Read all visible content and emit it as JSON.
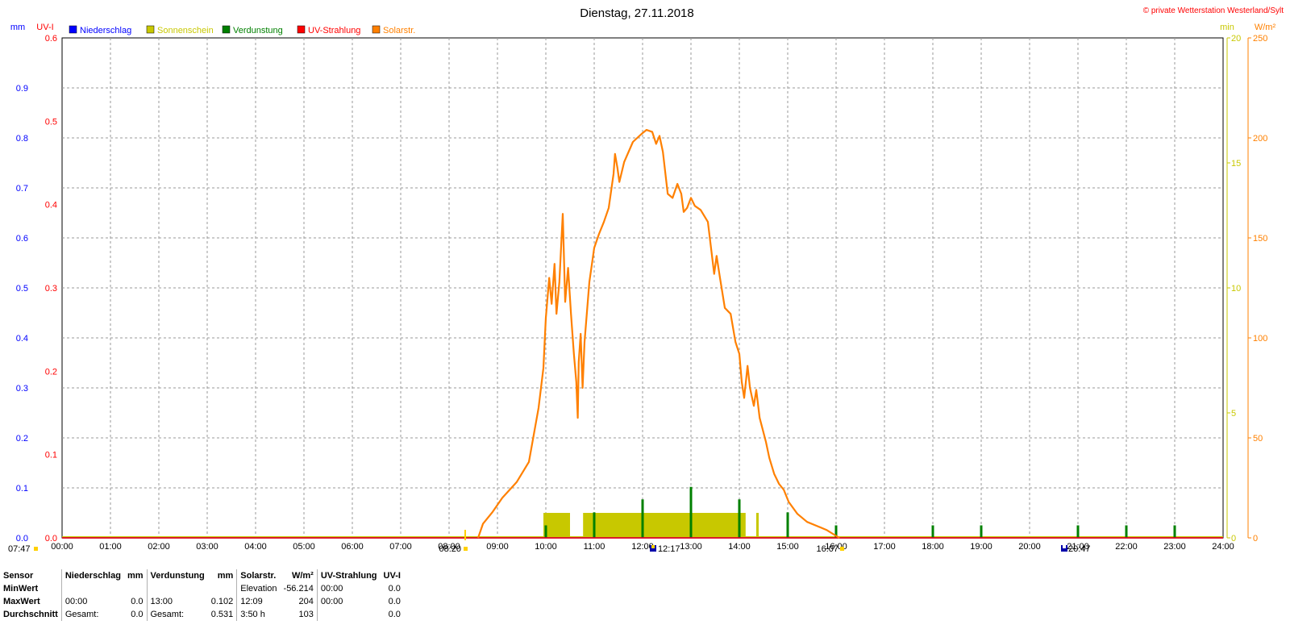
{
  "title": "Dienstag, 27.11.2018",
  "copyright": "© private Wetterstation Westerland/Sylt",
  "legend": [
    {
      "label": "Niederschlag",
      "color": "#0000ff"
    },
    {
      "label": "Sonnenschein",
      "color": "#c8c800"
    },
    {
      "label": "Verdunstung",
      "color": "#008000"
    },
    {
      "label": "UV-Strahlung",
      "color": "#ff0000"
    },
    {
      "label": "Solarstr.",
      "color": "#ff8000"
    }
  ],
  "units": {
    "mm": "mm",
    "uv": "UV-I",
    "min": "min",
    "wm2": "W/m²"
  },
  "sun_markers": {
    "sunrise_civil": "07:47",
    "sunrise": "08:20",
    "noon": "12:17",
    "sunset": "16:07",
    "moon": "20:47"
  },
  "chart_data": {
    "type": "line",
    "title": "Dienstag, 27.11.2018",
    "x_ticks": [
      "00:00",
      "01:00",
      "02:00",
      "03:00",
      "04:00",
      "05:00",
      "06:00",
      "07:00",
      "08:00",
      "09:00",
      "10:00",
      "11:00",
      "12:00",
      "13:00",
      "14:00",
      "15:00",
      "16:00",
      "17:00",
      "18:00",
      "19:00",
      "20:00",
      "21:00",
      "22:00",
      "23:00",
      "24:00"
    ],
    "x_range_hours": [
      0,
      24
    ],
    "axes": {
      "mm": {
        "range": [
          0,
          1.0
        ],
        "ticks": [
          "0.0",
          "0.1",
          "0.2",
          "0.3",
          "0.4",
          "0.5",
          "0.6",
          "0.7",
          "0.8",
          "0.9"
        ],
        "color": "#0000ff"
      },
      "uv": {
        "range": [
          0,
          0.6
        ],
        "ticks": [
          "0.0",
          "0.1",
          "0.2",
          "0.3",
          "0.4",
          "0.5",
          "0.6"
        ],
        "color": "#ff0000"
      },
      "min": {
        "range": [
          0,
          20
        ],
        "ticks": [
          "0",
          "5",
          "10",
          "15",
          "20"
        ],
        "color": "#c8c800"
      },
      "wm2": {
        "range": [
          0,
          250
        ],
        "ticks": [
          "0",
          "50",
          "100",
          "150",
          "200",
          "250"
        ],
        "color": "#ff8000"
      }
    },
    "grid": true,
    "series": [
      {
        "name": "Solarstr.",
        "axis": "wm2",
        "color": "#ff8000",
        "points": [
          [
            8.6,
            0
          ],
          [
            8.7,
            7
          ],
          [
            8.9,
            13
          ],
          [
            9.1,
            20
          ],
          [
            9.4,
            28
          ],
          [
            9.65,
            38
          ],
          [
            9.85,
            65
          ],
          [
            9.95,
            85
          ],
          [
            10.0,
            110
          ],
          [
            10.07,
            130
          ],
          [
            10.12,
            117
          ],
          [
            10.18,
            137
          ],
          [
            10.22,
            112
          ],
          [
            10.28,
            128
          ],
          [
            10.35,
            162
          ],
          [
            10.4,
            118
          ],
          [
            10.46,
            135
          ],
          [
            10.52,
            112
          ],
          [
            10.58,
            92
          ],
          [
            10.63,
            78
          ],
          [
            10.66,
            60
          ],
          [
            10.68,
            88
          ],
          [
            10.72,
            102
          ],
          [
            10.76,
            75
          ],
          [
            10.8,
            98
          ],
          [
            10.9,
            128
          ],
          [
            11.0,
            145
          ],
          [
            11.1,
            152
          ],
          [
            11.2,
            158
          ],
          [
            11.3,
            165
          ],
          [
            11.4,
            182
          ],
          [
            11.43,
            192
          ],
          [
            11.48,
            185
          ],
          [
            11.52,
            178
          ],
          [
            11.62,
            188
          ],
          [
            11.8,
            198
          ],
          [
            11.98,
            202
          ],
          [
            12.08,
            204
          ],
          [
            12.2,
            203
          ],
          [
            12.28,
            197
          ],
          [
            12.35,
            201
          ],
          [
            12.42,
            193
          ],
          [
            12.52,
            172
          ],
          [
            12.62,
            170
          ],
          [
            12.72,
            177
          ],
          [
            12.8,
            172
          ],
          [
            12.85,
            163
          ],
          [
            12.92,
            165
          ],
          [
            13.0,
            170
          ],
          [
            13.08,
            166
          ],
          [
            13.2,
            164
          ],
          [
            13.35,
            158
          ],
          [
            13.42,
            144
          ],
          [
            13.48,
            132
          ],
          [
            13.53,
            141
          ],
          [
            13.6,
            130
          ],
          [
            13.7,
            115
          ],
          [
            13.82,
            112
          ],
          [
            13.92,
            98
          ],
          [
            14.0,
            92
          ],
          [
            14.05,
            78
          ],
          [
            14.1,
            70
          ],
          [
            14.17,
            86
          ],
          [
            14.22,
            75
          ],
          [
            14.3,
            66
          ],
          [
            14.35,
            74
          ],
          [
            14.42,
            60
          ],
          [
            14.55,
            48
          ],
          [
            14.62,
            40
          ],
          [
            14.72,
            32
          ],
          [
            14.82,
            27
          ],
          [
            14.92,
            24
          ],
          [
            15.02,
            18
          ],
          [
            15.2,
            12
          ],
          [
            15.4,
            8
          ],
          [
            15.6,
            6
          ],
          [
            15.8,
            4
          ],
          [
            16.0,
            1
          ],
          [
            16.07,
            0
          ]
        ]
      },
      {
        "name": "Sonnenschein",
        "axis": "min",
        "color": "#c8c800",
        "blocks": [
          [
            9.95,
            10.5,
            1.0
          ],
          [
            10.77,
            14.13,
            1.0
          ],
          [
            14.35,
            14.4,
            1.0
          ]
        ]
      },
      {
        "name": "Verdunstung",
        "axis": "mm",
        "color": "#008000",
        "spikes": [
          [
            10.0,
            0.025
          ],
          [
            11.0,
            0.051
          ],
          [
            12.0,
            0.077
          ],
          [
            13.0,
            0.102
          ],
          [
            14.0,
            0.077
          ],
          [
            15.0,
            0.051
          ],
          [
            16.0,
            0.025
          ],
          [
            18.0,
            0.025
          ],
          [
            19.0,
            0.025
          ],
          [
            21.0,
            0.025
          ],
          [
            22.0,
            0.025
          ],
          [
            23.0,
            0.025
          ]
        ]
      },
      {
        "name": "Niederschlag",
        "axis": "mm",
        "color": "#0000ff",
        "constant": 0.0
      },
      {
        "name": "UV-Strahlung",
        "axis": "uv",
        "color": "#ff0000",
        "constant": 0.0
      }
    ]
  },
  "stats": {
    "headers": {
      "sensor": "Sensor",
      "niederschlag": "Niederschlag",
      "mm1": "mm",
      "verdunstung": "Verdunstung",
      "mm2": "mm",
      "solar": "Solarstr.",
      "wm2": "W/m²",
      "uv": "UV-Strahlung",
      "uvi": "UV-I"
    },
    "rows": [
      {
        "label": "MinWert",
        "n_time": "",
        "n_val": "",
        "v_time": "",
        "v_val": "",
        "s_time": "Elevation",
        "s_val": "-56.214",
        "u_time": "00:00",
        "u_val": "0.0"
      },
      {
        "label": "MaxWert",
        "n_time": "00:00",
        "n_val": "0.0",
        "v_time": "13:00",
        "v_val": "0.102",
        "s_time": "12:09",
        "s_val": "204",
        "u_time": "00:00",
        "u_val": "0.0"
      },
      {
        "label": "Durchschnitt",
        "n_time": "Gesamt:",
        "n_val": "0.0",
        "v_time": "Gesamt:",
        "v_val": "0.531",
        "s_time": "3:50 h",
        "s_val": "103",
        "u_time": "",
        "u_val": "0.0"
      }
    ]
  }
}
